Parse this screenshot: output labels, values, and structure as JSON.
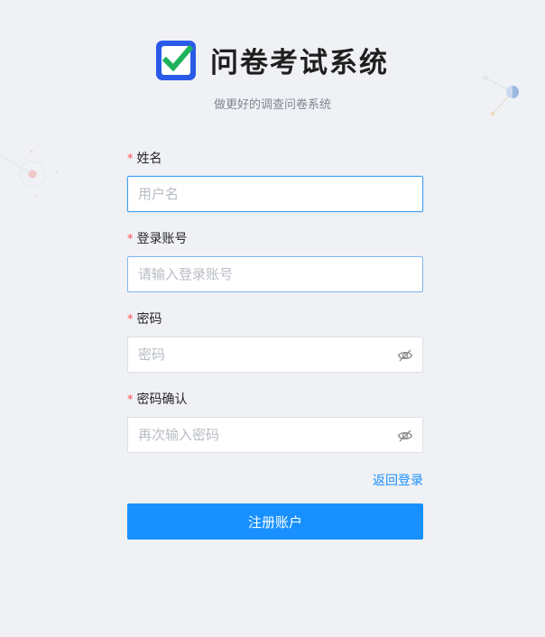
{
  "header": {
    "title": "问卷考试系统",
    "subtitle": "做更好的调查问卷系统"
  },
  "form": {
    "required_mark": "*",
    "fields": [
      {
        "label": "姓名",
        "placeholder": "用户名",
        "value": ""
      },
      {
        "label": "登录账号",
        "placeholder": "请输入登录账号",
        "value": ""
      },
      {
        "label": "密码",
        "placeholder": "密码",
        "value": ""
      },
      {
        "label": "密码确认",
        "placeholder": "再次输入密码",
        "value": ""
      }
    ],
    "back_login_label": "返回登录",
    "submit_label": "注册账户"
  },
  "colors": {
    "accent": "#1890ff",
    "logo": "#2a5be8",
    "check": "#1eb35a",
    "background": "#eff1f5"
  },
  "icons": {
    "logo": "checkbox-icon",
    "password_toggle": "eye-off-icon"
  }
}
